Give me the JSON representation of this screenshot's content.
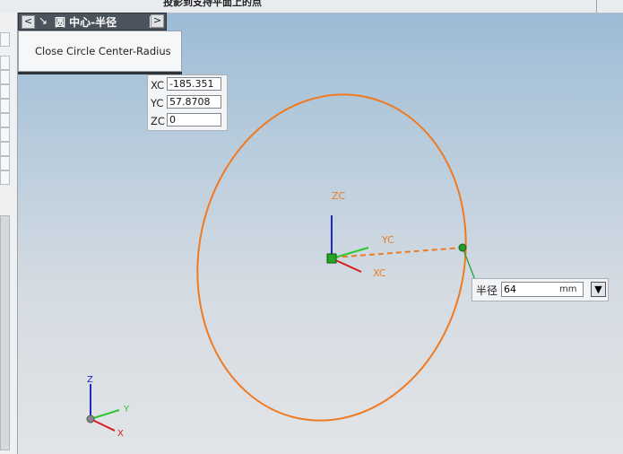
{
  "status_text": "投影到支持平面上的点",
  "command": {
    "title": "圆 中心-半径",
    "prev_label": "<",
    "next_label": ">",
    "pin_label": "↘",
    "close_label": "✕"
  },
  "menu": {
    "item": "Close Circle Center-Radius"
  },
  "coords": {
    "xc_label": "XC",
    "xc_value": "-185.351",
    "yc_label": "YC",
    "yc_value": "57.8708",
    "zc_label": "ZC",
    "zc_value": "0"
  },
  "radius": {
    "label": "半径",
    "value": "64",
    "unit": "mm",
    "dropdown_icon": "arrow-down-icon"
  },
  "axes_center": {
    "zc": "ZC",
    "yc": "YC",
    "xc": "XC"
  },
  "axes_corner": {
    "z": "Z",
    "y": "Y",
    "x": "X"
  },
  "colors": {
    "circle": "#f07a22",
    "axis_z": "#2226c8",
    "axis_y": "#2fc72f",
    "axis_x": "#d81e1e",
    "center_marker": "#27a327"
  }
}
